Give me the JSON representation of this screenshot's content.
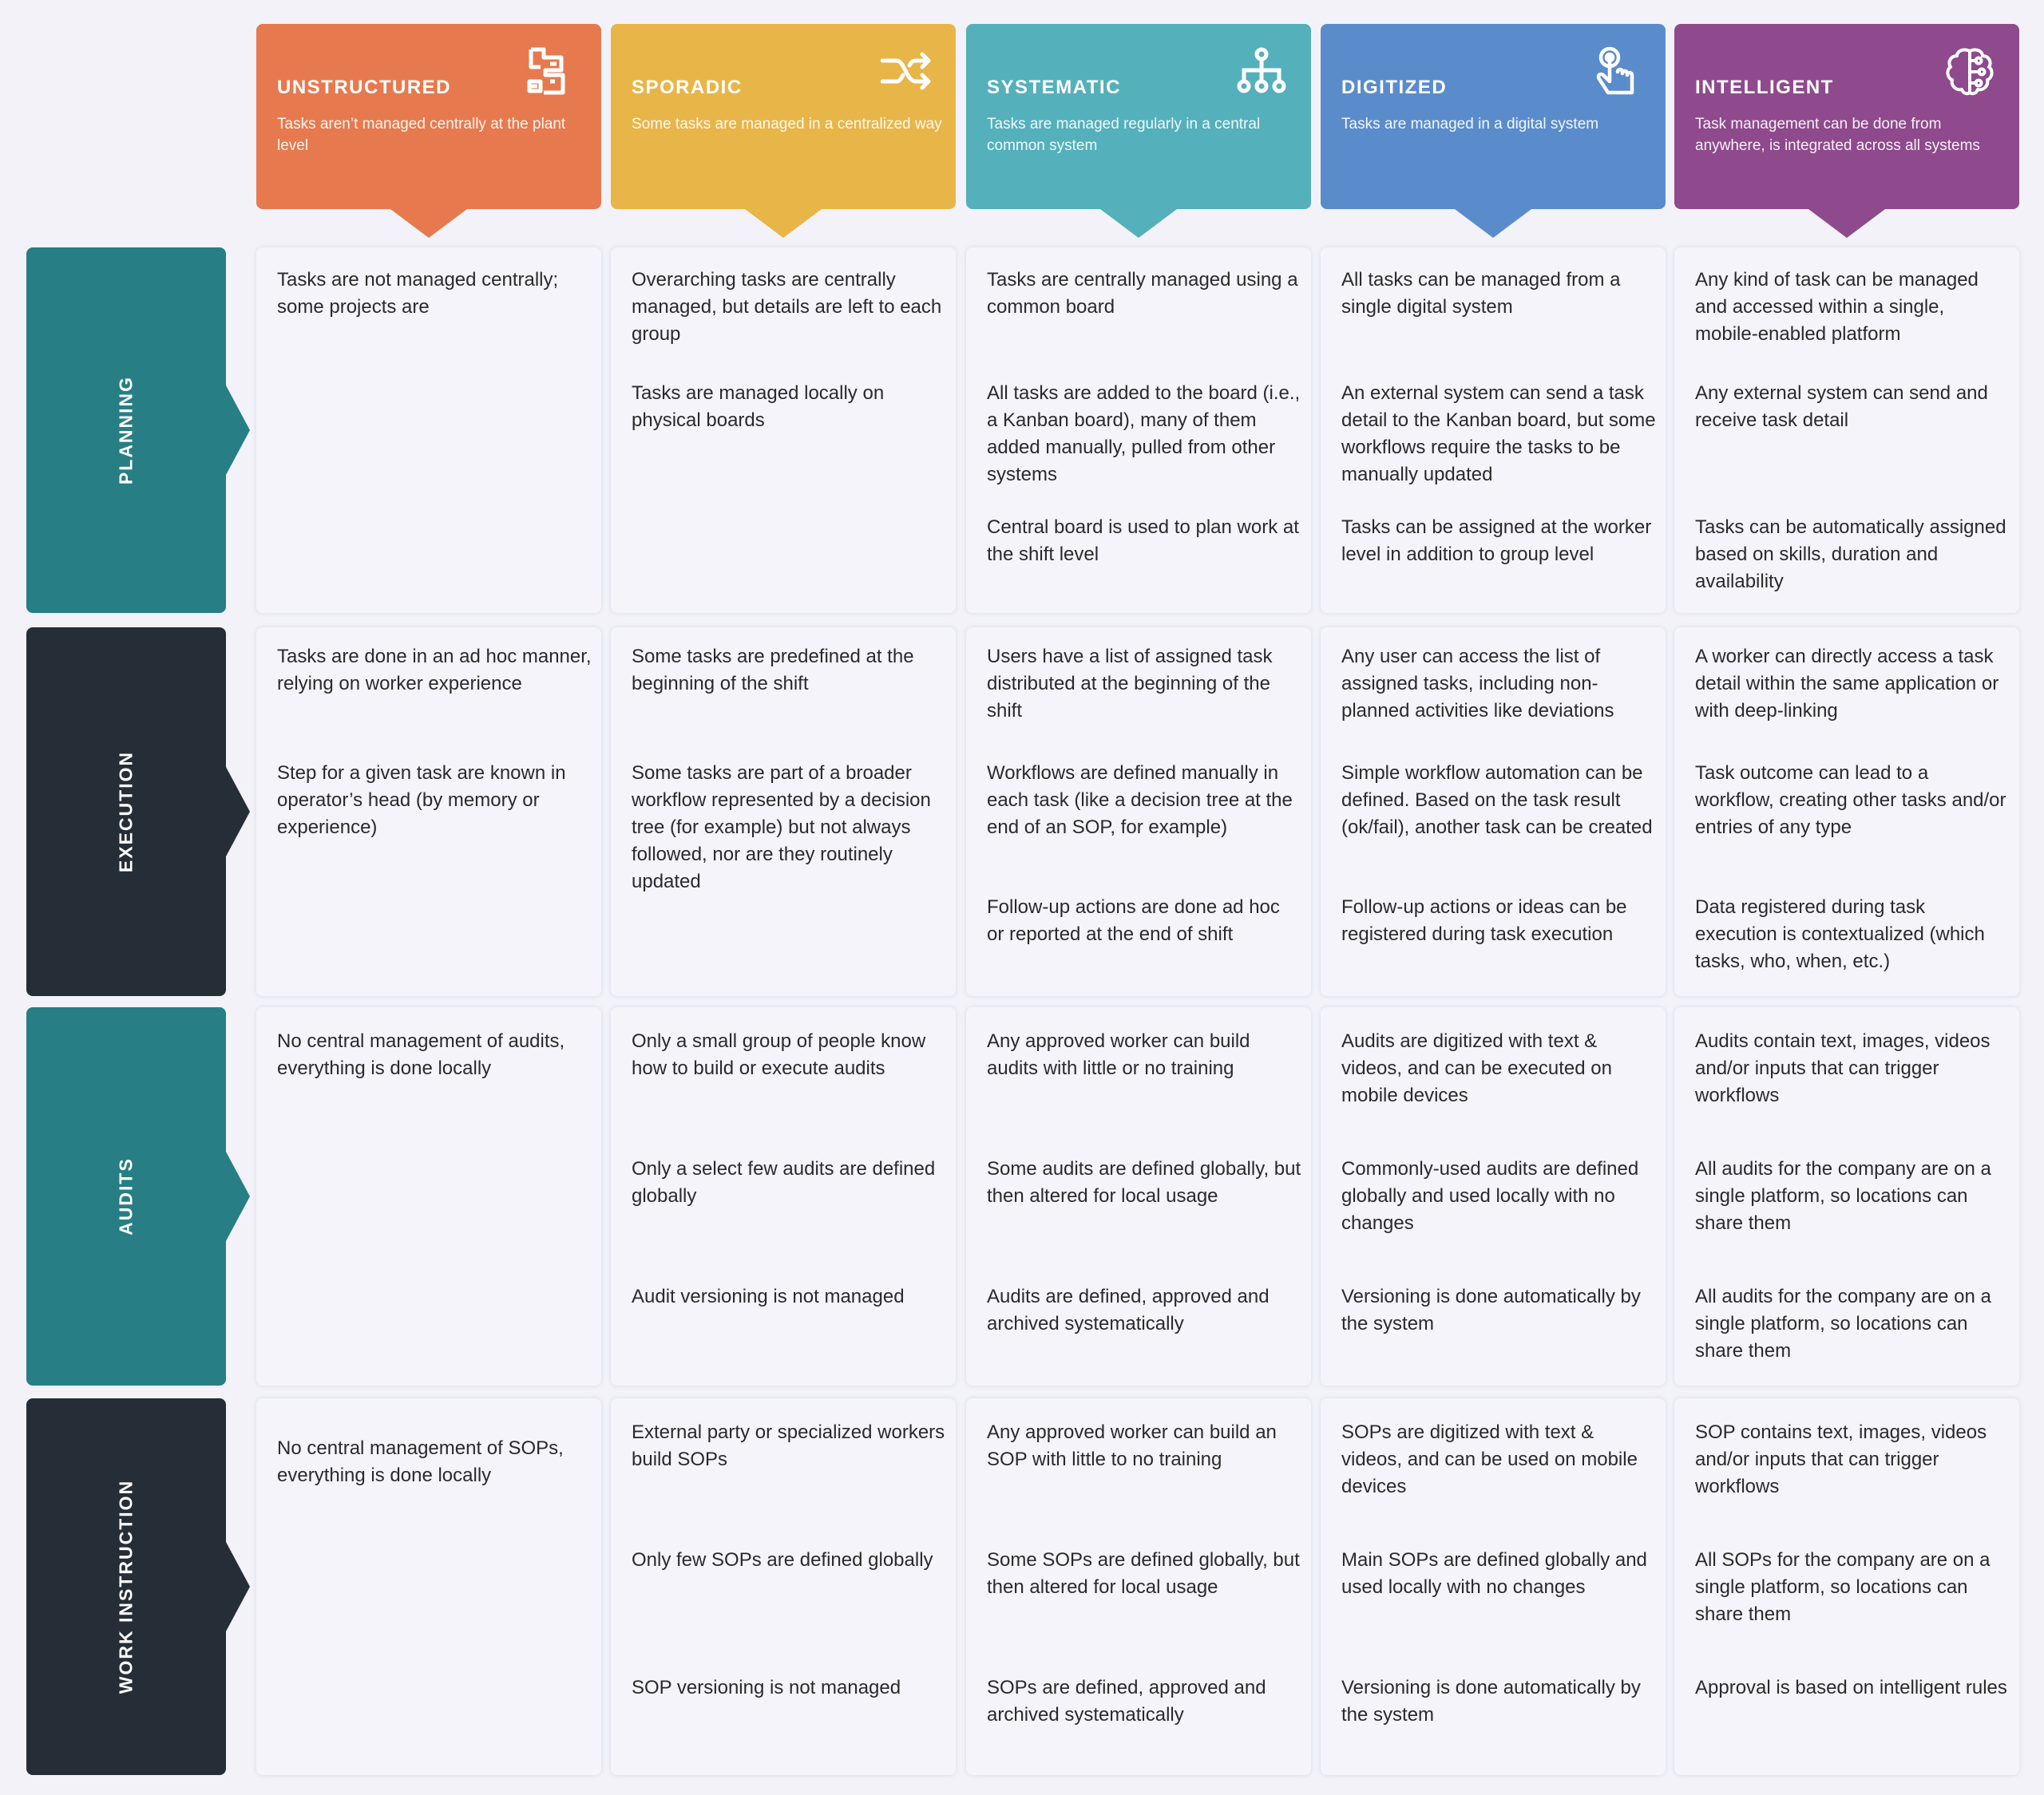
{
  "colors": {
    "background": "#f2f2f8",
    "cell_background": "#f4f4fa",
    "unstructured": "#e67a4e",
    "sporadic": "#e8b548",
    "systematic": "#54b0bb",
    "digitized": "#5a8ccb",
    "intelligent": "#8e4a8c",
    "row_teal": "#277e84",
    "row_dark": "#252e37"
  },
  "levels": [
    {
      "title": "UNSTRUCTURED",
      "description": "Tasks aren’t managed centrally at the plant level",
      "icon": "maze-icon"
    },
    {
      "title": "SPORADIC",
      "description": "Some tasks are managed in a centralized way",
      "icon": "shuffle-icon"
    },
    {
      "title": "SYSTEMATIC",
      "description": "Tasks are managed regularly in a central common system",
      "icon": "hierarchy-icon"
    },
    {
      "title": "DIGITIZED",
      "description": "Tasks are managed in a digital system",
      "icon": "touch-hand-icon"
    },
    {
      "title": "INTELLIGENT",
      "description": "Task management can be done from anywhere, is integrated across all systems",
      "icon": "brain-circuit-icon"
    }
  ],
  "rows": [
    {
      "label": "PLANNING",
      "cells": [
        [
          "Tasks are not managed centrally; some projects are"
        ],
        [
          "Overarching tasks are centrally managed, but details are left to each group",
          "Tasks are managed locally on physical boards"
        ],
        [
          "Tasks are centrally managed using a common board",
          "All tasks are added to the board (i.e., a Kanban board), many of them added manually, pulled from other systems",
          "Central board is used to plan work at the shift level"
        ],
        [
          "All tasks can be managed from a single digital system",
          "An external system can send a task detail to the Kanban board, but some workflows require the tasks to be manually updated",
          "Tasks can be assigned at the worker level in addition to group level"
        ],
        [
          "Any kind of task can be managed and accessed within a single, mobile-enabled platform",
          "Any external system can send and receive task detail",
          "Tasks can be automatically assigned based on skills, duration and availability"
        ]
      ]
    },
    {
      "label": "EXECUTION",
      "cells": [
        [
          "Tasks are done in an ad hoc manner, relying on worker experience",
          "Step for a given task are known in operator’s head (by memory or experience)"
        ],
        [
          "Some tasks are predefined at the beginning of the shift",
          "Some tasks are part of a broader workflow represented by a decision tree (for example) but not always followed, nor are they routinely updated"
        ],
        [
          "Users have a list of assigned task distributed at the beginning of the shift",
          "Workflows are defined manually in each task (like a decision tree at the end of an SOP, for example)",
          "Follow-up actions are done ad hoc or reported at the end of shift"
        ],
        [
          "Any user can access the list of assigned tasks, including non-planned activities like deviations",
          "Simple workflow automation can be defined. Based on the task result (ok/fail), another task can be created",
          "Follow-up actions or ideas can be registered during task execution"
        ],
        [
          "A worker can directly access a task detail within the same application or with deep-linking",
          "Task outcome can lead to a workflow, creating other tasks and/or entries of any type",
          "Data registered during task execution is contextualized (which tasks, who, when, etc.)"
        ]
      ]
    },
    {
      "label": "AUDITS",
      "cells": [
        [
          "No central management of audits, everything is done locally"
        ],
        [
          "Only a small group of people know how to build or execute audits",
          "Only a select few audits are defined globally",
          "Audit versioning is not managed"
        ],
        [
          "Any approved worker can build audits with little or no training",
          "Some audits are defined globally, but then altered for local usage",
          "Audits are defined, approved and archived systematically"
        ],
        [
          "Audits are digitized with text & videos, and can be executed on mobile devices",
          "Commonly-used audits are defined globally and used locally with no changes",
          "Versioning is done automatically by the system"
        ],
        [
          "Audits contain text, images, videos and/or inputs that can trigger workflows",
          "All audits for the company are on a single platform, so locations can share them",
          "All audits for the company are on a single platform, so locations can share them"
        ]
      ]
    },
    {
      "label": "WORK INSTRUCTION",
      "cells": [
        [
          "No central management of SOPs, everything is done locally"
        ],
        [
          "External party or specialized workers build SOPs",
          "Only few SOPs are defined globally",
          "SOP versioning is not managed"
        ],
        [
          "Any approved worker can build an SOP with little to no training",
          "Some SOPs are defined globally, but then altered for local usage",
          "SOPs are defined, approved and archived systematically"
        ],
        [
          "SOPs are digitized with text & videos, and can be used on mobile devices",
          "Main SOPs are defined globally and used locally with no changes",
          "Versioning is done automatically by the system"
        ],
        [
          "SOP contains text, images, videos and/or inputs that can trigger workflows",
          "All SOPs for the company are on a single platform, so locations can share them",
          "Approval is based on intelligent rules"
        ]
      ]
    }
  ]
}
